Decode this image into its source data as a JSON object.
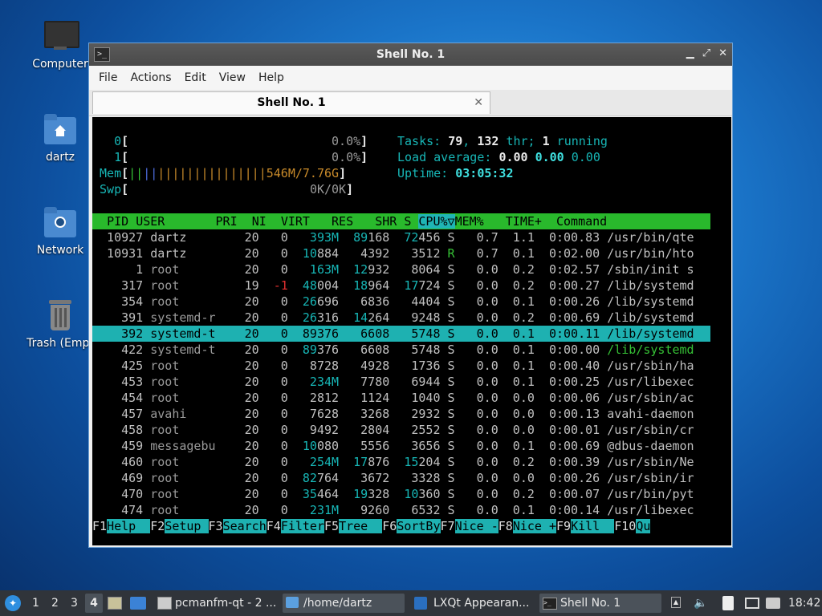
{
  "desktop": {
    "icons": [
      {
        "label": "Computer"
      },
      {
        "label": "dartz"
      },
      {
        "label": "Network"
      },
      {
        "label": "Trash (Empt"
      }
    ]
  },
  "window": {
    "title": "Shell No. 1",
    "menu": [
      "File",
      "Actions",
      "Edit",
      "View",
      "Help"
    ],
    "tab_label": "Shell No. 1"
  },
  "htop": {
    "cpu0": {
      "id": "0",
      "value": "0.0%"
    },
    "cpu1": {
      "id": "1",
      "value": "0.0%"
    },
    "mem": {
      "label": "Mem",
      "bars": "|||||||||||||||||||",
      "value": "546M/7.76G"
    },
    "swp": {
      "label": "Swp",
      "value": "0K/0K"
    },
    "tasks": {
      "label": "Tasks: ",
      "count": "79",
      "sep": ", ",
      "threads": "132",
      "thr_label": " thr; ",
      "running": "1",
      "running_label": " running"
    },
    "load": {
      "label": "Load average: ",
      "v1": "0.00",
      "v2": "0.00",
      "v3": "0.00"
    },
    "uptime": {
      "label": "Uptime: ",
      "value": "03:05:32"
    },
    "columns": [
      "PID",
      "USER",
      "PRI",
      "NI",
      "VIRT",
      "RES",
      "SHR",
      "S",
      "CPU%▽",
      "MEM%",
      "TIME+",
      "Command"
    ],
    "processes": [
      {
        "pid": "10927",
        "user": "dartz",
        "pri": "20",
        "ni": "0",
        "virt": "393M",
        "res": "89168",
        "shr": "72456",
        "s": "S",
        "cpu": "0.7",
        "mem": "1.1",
        "time": "0:00.83",
        "cmd": "/usr/bin/qte"
      },
      {
        "pid": "10931",
        "user": "dartz",
        "pri": "20",
        "ni": "0",
        "virt": "10884",
        "res": "4392",
        "shr": "3512",
        "s": "R",
        "cpu": "0.7",
        "mem": "0.1",
        "time": "0:02.00",
        "cmd": "/usr/bin/hto"
      },
      {
        "pid": "1",
        "user": "root",
        "pri": "20",
        "ni": "0",
        "virt": "163M",
        "res": "12932",
        "shr": "8064",
        "s": "S",
        "cpu": "0.0",
        "mem": "0.2",
        "time": "0:02.57",
        "cmd": "/sbin/init s"
      },
      {
        "pid": "317",
        "user": "root",
        "pri": "19",
        "ni": "-1",
        "virt": "48004",
        "res": "18964",
        "shr": "17724",
        "s": "S",
        "cpu": "0.0",
        "mem": "0.2",
        "time": "0:00.27",
        "cmd": "/lib/systemd"
      },
      {
        "pid": "354",
        "user": "root",
        "pri": "20",
        "ni": "0",
        "virt": "26696",
        "res": "6836",
        "shr": "4404",
        "s": "S",
        "cpu": "0.0",
        "mem": "0.1",
        "time": "0:00.26",
        "cmd": "/lib/systemd"
      },
      {
        "pid": "391",
        "user": "systemd-r",
        "pri": "20",
        "ni": "0",
        "virt": "26316",
        "res": "14264",
        "shr": "9248",
        "s": "S",
        "cpu": "0.0",
        "mem": "0.2",
        "time": "0:00.69",
        "cmd": "/lib/systemd"
      },
      {
        "pid": "392",
        "user": "systemd-t",
        "pri": "20",
        "ni": "0",
        "virt": "89376",
        "res": "6608",
        "shr": "5748",
        "s": "S",
        "cpu": "0.0",
        "mem": "0.1",
        "time": "0:00.11",
        "cmd": "/lib/systemd"
      },
      {
        "pid": "422",
        "user": "systemd-t",
        "pri": "20",
        "ni": "0",
        "virt": "89376",
        "res": "6608",
        "shr": "5748",
        "s": "S",
        "cpu": "0.0",
        "mem": "0.1",
        "time": "0:00.00",
        "cmd": "/lib/systemd"
      },
      {
        "pid": "425",
        "user": "root",
        "pri": "20",
        "ni": "0",
        "virt": "8728",
        "res": "4928",
        "shr": "1736",
        "s": "S",
        "cpu": "0.0",
        "mem": "0.1",
        "time": "0:00.40",
        "cmd": "/usr/sbin/ha"
      },
      {
        "pid": "453",
        "user": "root",
        "pri": "20",
        "ni": "0",
        "virt": "234M",
        "res": "7780",
        "shr": "6944",
        "s": "S",
        "cpu": "0.0",
        "mem": "0.1",
        "time": "0:00.25",
        "cmd": "/usr/libexec"
      },
      {
        "pid": "454",
        "user": "root",
        "pri": "20",
        "ni": "0",
        "virt": "2812",
        "res": "1124",
        "shr": "1040",
        "s": "S",
        "cpu": "0.0",
        "mem": "0.0",
        "time": "0:00.06",
        "cmd": "/usr/sbin/ac"
      },
      {
        "pid": "457",
        "user": "avahi",
        "pri": "20",
        "ni": "0",
        "virt": "7628",
        "res": "3268",
        "shr": "2932",
        "s": "S",
        "cpu": "0.0",
        "mem": "0.0",
        "time": "0:00.13",
        "cmd": "avahi-daemon"
      },
      {
        "pid": "458",
        "user": "root",
        "pri": "20",
        "ni": "0",
        "virt": "9492",
        "res": "2804",
        "shr": "2552",
        "s": "S",
        "cpu": "0.0",
        "mem": "0.0",
        "time": "0:00.01",
        "cmd": "/usr/sbin/cr"
      },
      {
        "pid": "459",
        "user": "messagebu",
        "pri": "20",
        "ni": "0",
        "virt": "10080",
        "res": "5556",
        "shr": "3656",
        "s": "S",
        "cpu": "0.0",
        "mem": "0.1",
        "time": "0:00.69",
        "cmd": "@dbus-daemon"
      },
      {
        "pid": "460",
        "user": "root",
        "pri": "20",
        "ni": "0",
        "virt": "254M",
        "res": "17876",
        "shr": "15204",
        "s": "S",
        "cpu": "0.0",
        "mem": "0.2",
        "time": "0:00.39",
        "cmd": "/usr/sbin/Ne"
      },
      {
        "pid": "469",
        "user": "root",
        "pri": "20",
        "ni": "0",
        "virt": "82764",
        "res": "3672",
        "shr": "3328",
        "s": "S",
        "cpu": "0.0",
        "mem": "0.0",
        "time": "0:00.26",
        "cmd": "/usr/sbin/ir"
      },
      {
        "pid": "470",
        "user": "root",
        "pri": "20",
        "ni": "0",
        "virt": "35464",
        "res": "19328",
        "shr": "10360",
        "s": "S",
        "cpu": "0.0",
        "mem": "0.2",
        "time": "0:00.07",
        "cmd": "/usr/bin/pyt"
      },
      {
        "pid": "474",
        "user": "root",
        "pri": "20",
        "ni": "0",
        "virt": "231M",
        "res": "9260",
        "shr": "6532",
        "s": "S",
        "cpu": "0.0",
        "mem": "0.1",
        "time": "0:00.14",
        "cmd": "/usr/libexec"
      }
    ],
    "selected_index": 6,
    "fkeys": [
      {
        "key": "F1",
        "label": "Help  "
      },
      {
        "key": "F2",
        "label": "Setup "
      },
      {
        "key": "F3",
        "label": "Search"
      },
      {
        "key": "F4",
        "label": "Filter"
      },
      {
        "key": "F5",
        "label": "Tree  "
      },
      {
        "key": "F6",
        "label": "SortBy"
      },
      {
        "key": "F7",
        "label": "Nice -"
      },
      {
        "key": "F8",
        "label": "Nice +"
      },
      {
        "key": "F9",
        "label": "Kill  "
      },
      {
        "key": "F10",
        "label": "Qu"
      }
    ]
  },
  "taskbar": {
    "workspaces": [
      "1",
      "2",
      "3",
      "4"
    ],
    "active_workspace": "4",
    "tasks": [
      {
        "label": "pcmanfm-qt - 2 ..."
      },
      {
        "label": "/home/dartz"
      },
      {
        "label": "LXQt Appearan..."
      },
      {
        "label": "Shell No. 1"
      }
    ],
    "clock": "18:42"
  }
}
